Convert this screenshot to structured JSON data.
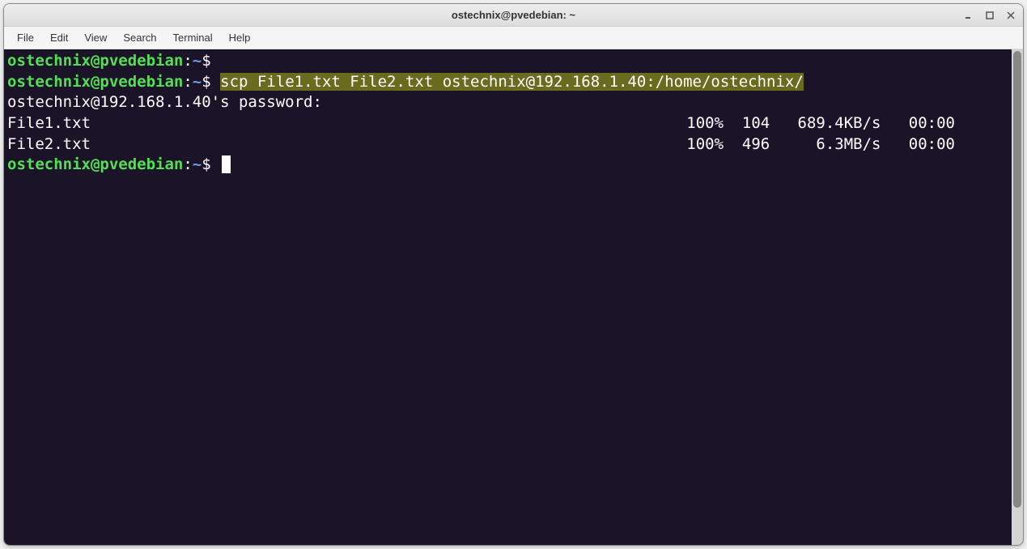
{
  "window": {
    "title": "ostechnix@pvedebian: ~"
  },
  "menu": {
    "file": "File",
    "edit": "Edit",
    "view": "View",
    "search": "Search",
    "terminal": "Terminal",
    "help": "Help"
  },
  "prompt": {
    "user_host": "ostechnix@pvedebian",
    "colon": ":",
    "path": "~",
    "symbol": "$"
  },
  "lines": {
    "cmd_highlight": "scp File1.txt File2.txt ostechnix@192.168.1.40:/home/ostechnix/",
    "password_prompt": "ostechnix@192.168.1.40's password:",
    "file1_name": "File1.txt",
    "file1_stats": "100%  104   689.4KB/s   00:00",
    "file2_name": "File2.txt",
    "file2_stats": "100%  496     6.3MB/s   00:00"
  }
}
